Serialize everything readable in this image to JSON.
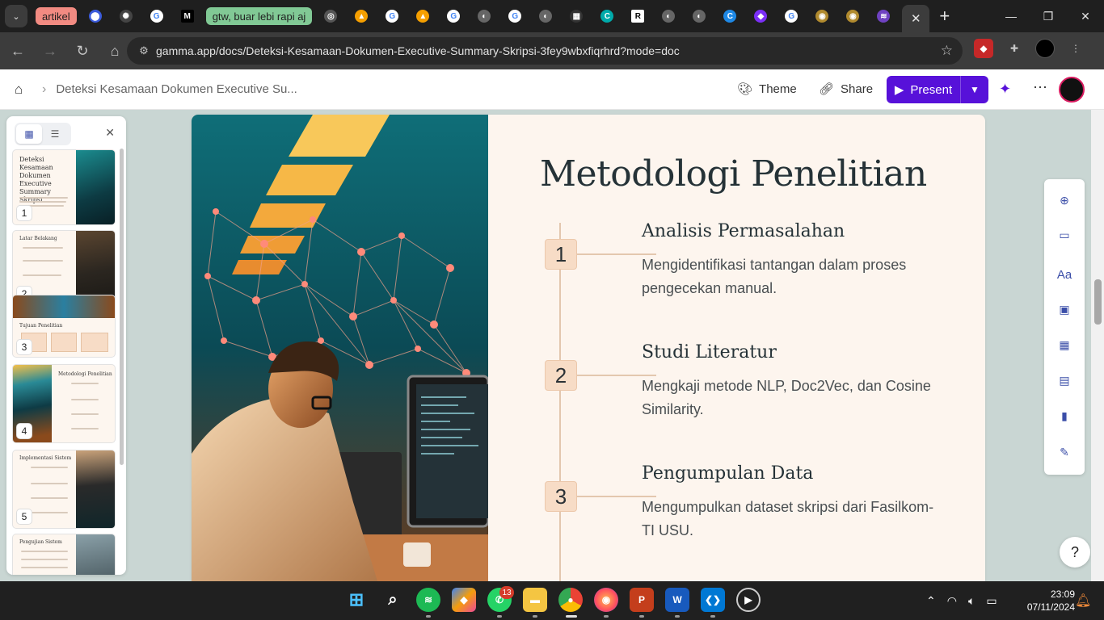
{
  "browser": {
    "tab_group_1": "artikel",
    "tab_group_2": "gtw, buar lebi rapi aj",
    "url": "gamma.app/docs/Deteksi-Kesamaan-Dokumen-Executive-Summary-Skripsi-3fey9wbxfiqrhrd?mode=doc"
  },
  "gamma": {
    "breadcrumb": "Deteksi Kesamaan Dokumen Executive Su...",
    "theme_label": "Theme",
    "share_label": "Share",
    "present_label": "Present"
  },
  "thumbnails": [
    {
      "num": "1",
      "title": "Deteksi Kesamaan Dokumen Executive Summary Skripsi"
    },
    {
      "num": "2",
      "title": "Latar Belakang"
    },
    {
      "num": "3",
      "title": "Tujuan Penelitian"
    },
    {
      "num": "4",
      "title": "Metodologi Penelitian"
    },
    {
      "num": "5",
      "title": "Implementasi Sistem"
    },
    {
      "num": "6",
      "title": "Pengujian Sistem"
    }
  ],
  "card": {
    "title": "Metodologi Penelitian",
    "steps": [
      {
        "num": "1",
        "title": "Analisis Permasalahan",
        "desc": "Mengidentifikasi tantangan dalam proses pengecekan manual."
      },
      {
        "num": "2",
        "title": "Studi Literatur",
        "desc": "Mengkaji metode NLP, Doc2Vec, dan Cosine Similarity."
      },
      {
        "num": "3",
        "title": "Pengumpulan Data",
        "desc": "Mengumpulkan dataset skripsi dari Fasilkom-TI USU."
      }
    ]
  },
  "help_label": "?",
  "taskbar": {
    "whatsapp_badge": "13",
    "time": "23:09",
    "date": "07/11/2024"
  },
  "colors": {
    "present_bg": "#5711d9",
    "card_bg": "#fdf5ee",
    "badge_bg": "#f7dcc6",
    "title_color": "#253237",
    "accent_icon": "#3b4ea8"
  }
}
